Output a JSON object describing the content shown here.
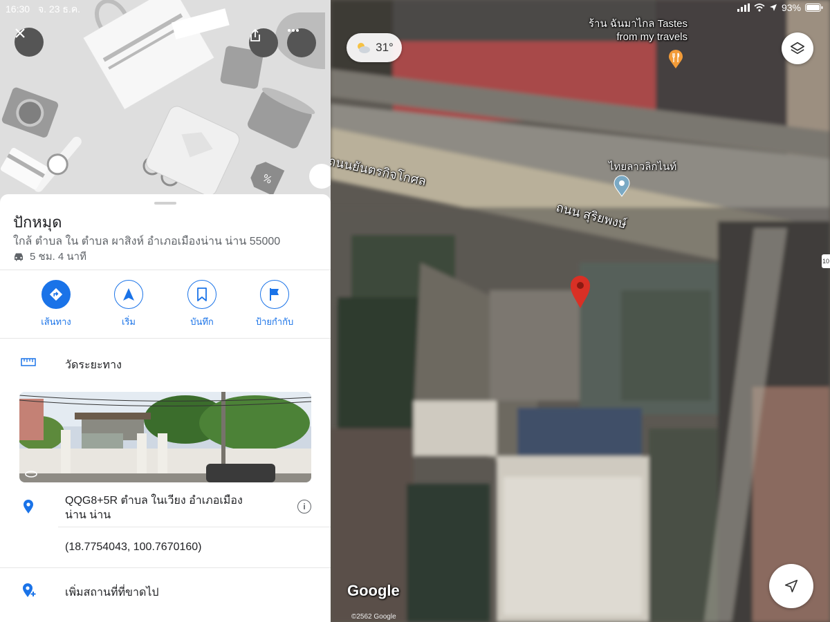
{
  "status_bar": {
    "time": "16:30",
    "date": "จ. 23 ธ.ค.",
    "battery": "93%"
  },
  "map": {
    "weather": {
      "temperature": "31°",
      "icon": "partly-cloudy-icon"
    },
    "labels": {
      "restaurant_line1": "ร้าน ฉันมาไกล Tastes",
      "restaurant_line2": "from my travels",
      "casino": "ไทยลาวลิกไนท์",
      "road_upper": "ถนนยันตรกิจโกศล",
      "road_main": "ถนน สุริยพงษ์",
      "edge_badge": "10"
    },
    "google_logo": "Google",
    "copyright": "©2562 Google"
  },
  "panel": {
    "title": "ปักหมุด",
    "subtitle": "ใกล้ ตำบล ใน ตำบล ผาสิงห์ อำเภอเมืองน่าน น่าน 55000",
    "drive_time": "5 ชม. 4 นาที",
    "actions": [
      {
        "label": "เส้นทาง",
        "icon": "directions-icon"
      },
      {
        "label": "เริ่ม",
        "icon": "navigation-arrow-icon"
      },
      {
        "label": "บันทึก",
        "icon": "bookmark-icon"
      },
      {
        "label": "ป้ายกำกับ",
        "icon": "flag-icon"
      }
    ],
    "measure_distance": "วัดระยะทาง",
    "plus_code_line1": "QQG8+5R ตำบล ในเวียง อำเภอเมือง",
    "plus_code_line2": "น่าน น่าน",
    "coordinates": "(18.7754043, 100.7670160)",
    "add_missing_place": "เพิ่มสถานที่ที่ขาดไป",
    "info_glyph": "i"
  },
  "colors": {
    "accent": "#1a73e8",
    "pin_red": "#d93025",
    "restaurant_orange": "#f29b38"
  }
}
